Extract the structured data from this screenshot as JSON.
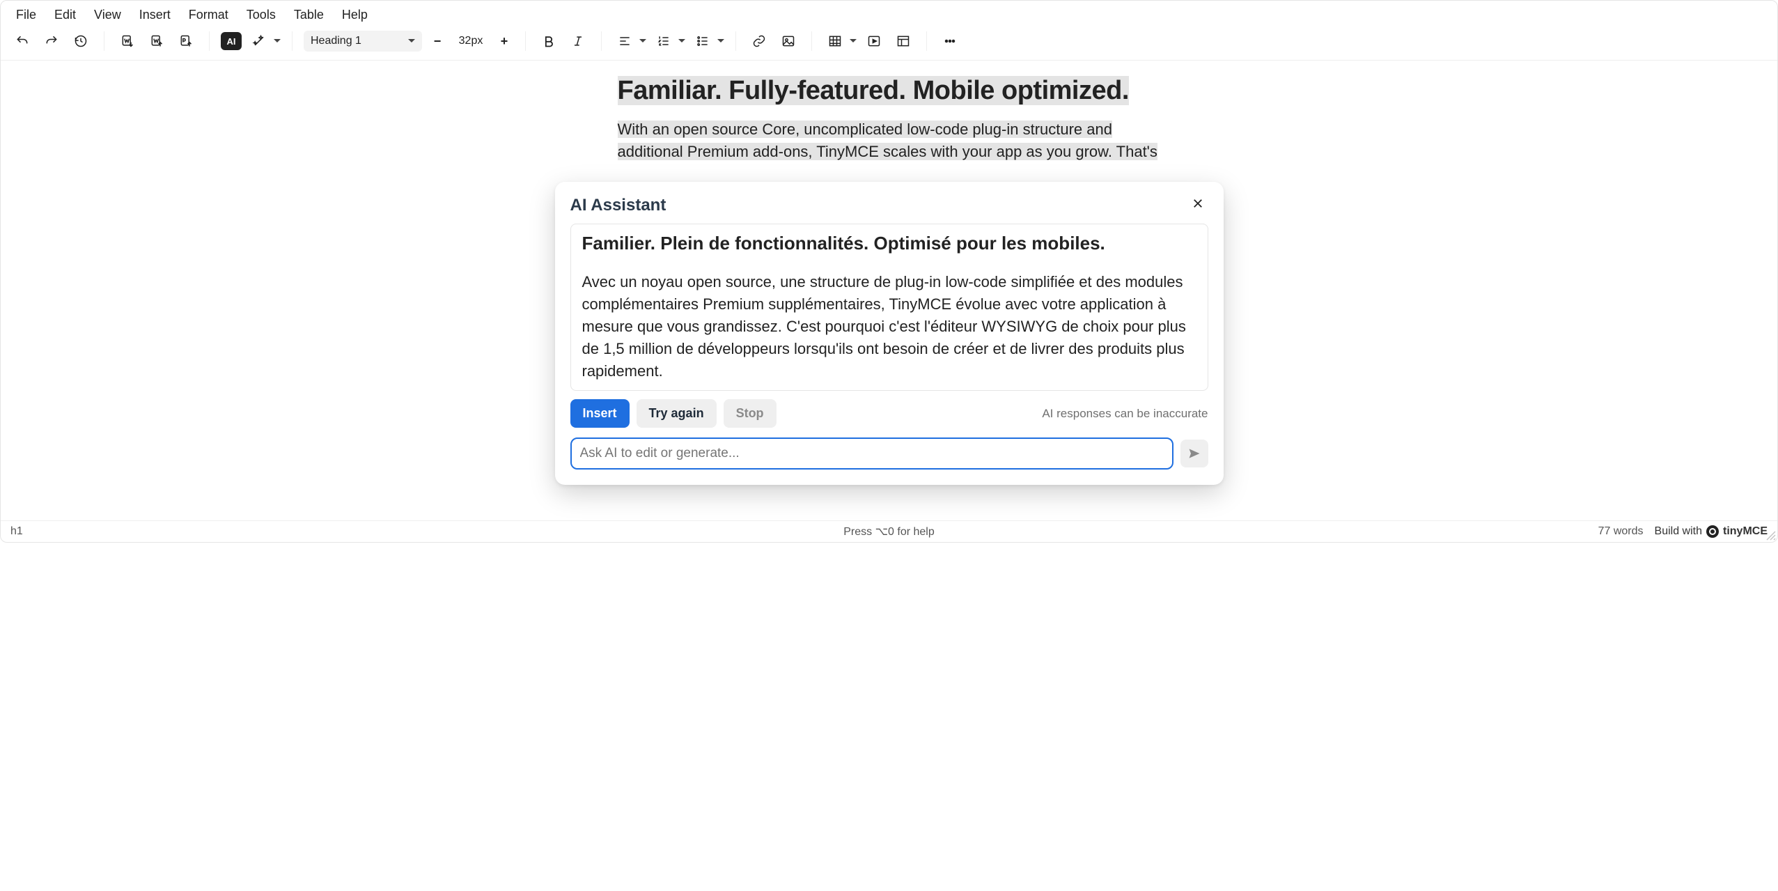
{
  "menubar": [
    "File",
    "Edit",
    "View",
    "Insert",
    "Format",
    "Tools",
    "Table",
    "Help"
  ],
  "toolbar": {
    "block_format": "Heading 1",
    "font_size": "32px",
    "ai_label": "AI"
  },
  "editor": {
    "headline": "Familiar. Fully-featured. Mobile optimized.",
    "paragraph_visible_line1": "With an open source Core, uncomplicated low-code plug-in structure and",
    "paragraph_visible_line2": "additional Premium add-ons, TinyMCE scales with your app as you grow. That's"
  },
  "dialog": {
    "title": "AI Assistant",
    "result_heading": "Familier. Plein de fonctionnalités. Optimisé pour les mobiles.",
    "result_paragraph": "Avec un noyau open source, une structure de plug-in low-code simplifiée et des modules complémentaires Premium supplémentaires, TinyMCE évolue avec votre application à mesure que vous grandissez. C'est pourquoi c'est l'éditeur WYSIWYG de choix pour plus de 1,5 million de développeurs lorsqu'ils ont besoin de créer et de livrer des produits plus rapidement.",
    "insert": "Insert",
    "try_again": "Try again",
    "stop": "Stop",
    "disclaimer": "AI responses can be inaccurate",
    "prompt_placeholder": "Ask AI to edit or generate..."
  },
  "statusbar": {
    "path": "h1",
    "help_hint": "Press ⌥0 for help",
    "word_count": "77 words",
    "brand_prefix": "Build with ",
    "brand_name": "tinyMCE"
  }
}
